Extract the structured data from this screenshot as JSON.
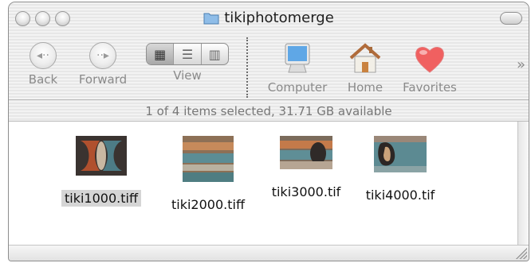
{
  "window": {
    "title": "tikiphotomerge"
  },
  "toolbar": {
    "back_label": "Back",
    "forward_label": "Forward",
    "view_label": "View",
    "computer_label": "Computer",
    "home_label": "Home",
    "favorites_label": "Favorites",
    "overflow_glyph": "»"
  },
  "status": {
    "text": "1 of 4 items selected, 31.71 GB available"
  },
  "files": [
    {
      "name": "tiki1000.tiff",
      "selected": true
    },
    {
      "name": "tiki2000.tiff",
      "selected": false
    },
    {
      "name": "tiki3000.tif",
      "selected": false
    },
    {
      "name": "tiki4000.tif",
      "selected": false
    }
  ],
  "icons": {
    "back": "back-arrow-icon",
    "forward": "forward-arrow-icon",
    "view_modes": [
      "icon-view-icon",
      "list-view-icon",
      "column-view-icon"
    ],
    "computer": "computer-icon",
    "home": "home-icon",
    "favorites": "heart-icon"
  },
  "colors": {
    "selection": "#d5d5d5",
    "favorites_heart": "#f06060",
    "computer_screen": "#5fa7e6"
  }
}
